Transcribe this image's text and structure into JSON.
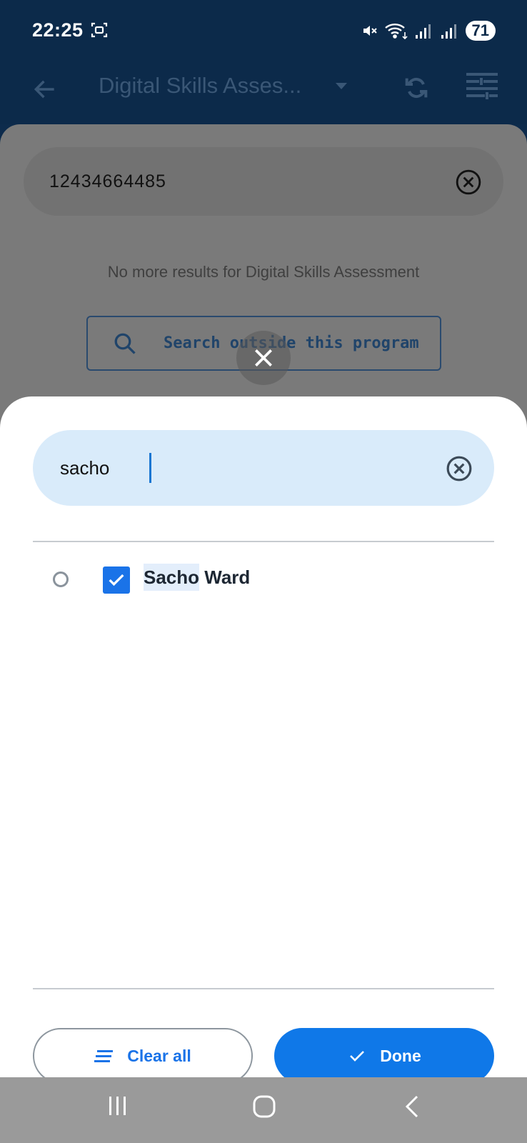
{
  "status_bar": {
    "time": "22:25",
    "battery": "71"
  },
  "app_bar": {
    "title": "Digital Skills Asses..."
  },
  "background_page": {
    "search_value": "12434664485",
    "no_results_message": "No more results for Digital Skills Assessment",
    "search_outside_label": "Search outside this program"
  },
  "sheet": {
    "search": {
      "value": "sacho",
      "placeholder": ""
    },
    "results": [
      {
        "highlight": "Sacho",
        "rest": " Ward",
        "checked": true
      }
    ],
    "clear_all_label": "Clear all",
    "done_label": "Done"
  },
  "colors": {
    "accent": "#1a73e8",
    "status_bar": "#0c2a4a",
    "search_fill": "#d9ebfa"
  }
}
